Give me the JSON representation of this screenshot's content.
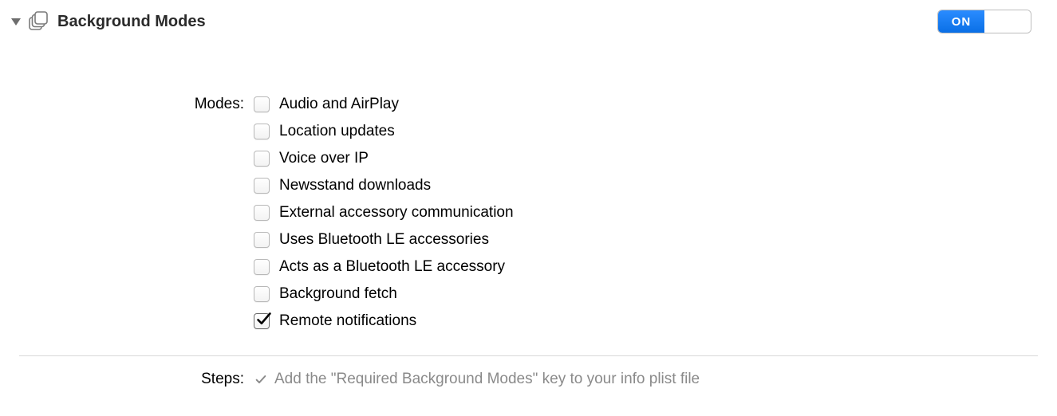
{
  "header": {
    "title": "Background Modes",
    "toggle_on_label": "ON",
    "toggle_state": "on"
  },
  "modes": {
    "label": "Modes:",
    "items": [
      {
        "label": "Audio and AirPlay",
        "checked": false
      },
      {
        "label": "Location updates",
        "checked": false
      },
      {
        "label": "Voice over IP",
        "checked": false
      },
      {
        "label": "Newsstand downloads",
        "checked": false
      },
      {
        "label": "External accessory communication",
        "checked": false
      },
      {
        "label": "Uses Bluetooth LE accessories",
        "checked": false
      },
      {
        "label": "Acts as a Bluetooth LE accessory",
        "checked": false
      },
      {
        "label": "Background fetch",
        "checked": false
      },
      {
        "label": "Remote notifications",
        "checked": true
      }
    ]
  },
  "steps": {
    "label": "Steps:",
    "items": [
      {
        "text": "Add the \"Required Background Modes\" key to your info plist file",
        "done": true
      }
    ]
  }
}
